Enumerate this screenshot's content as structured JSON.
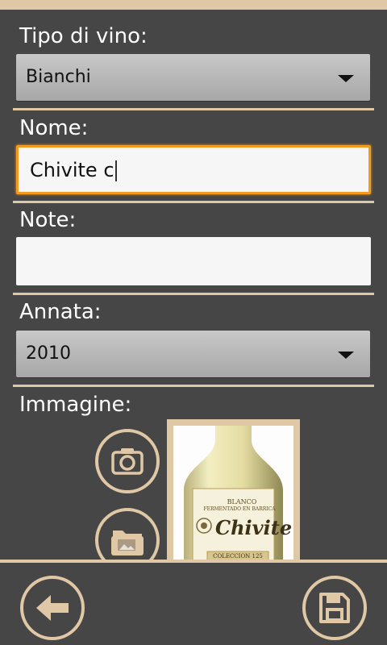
{
  "form": {
    "wine_type": {
      "label": "Tipo di vino:",
      "value": "Bianchi"
    },
    "name": {
      "label": "Nome:",
      "value": "Chivite c"
    },
    "notes": {
      "label": "Note:",
      "value": ""
    },
    "vintage": {
      "label": "Annata:",
      "value": "2010"
    },
    "image": {
      "label": "Immagine:",
      "bottle_brand": "Chivite",
      "bottle_type": "BLANCO",
      "bottle_subtitle": "FERMENTADO EN BARRICA",
      "bottle_collection": "COLECCION 125"
    }
  },
  "icons": {
    "camera": "camera-icon",
    "gallery": "folder-image-icon",
    "back": "back-arrow-icon",
    "save": "save-icon"
  },
  "colors": {
    "accent": "#e0c8a6",
    "background": "#464646",
    "focus": "#f39a1f"
  }
}
